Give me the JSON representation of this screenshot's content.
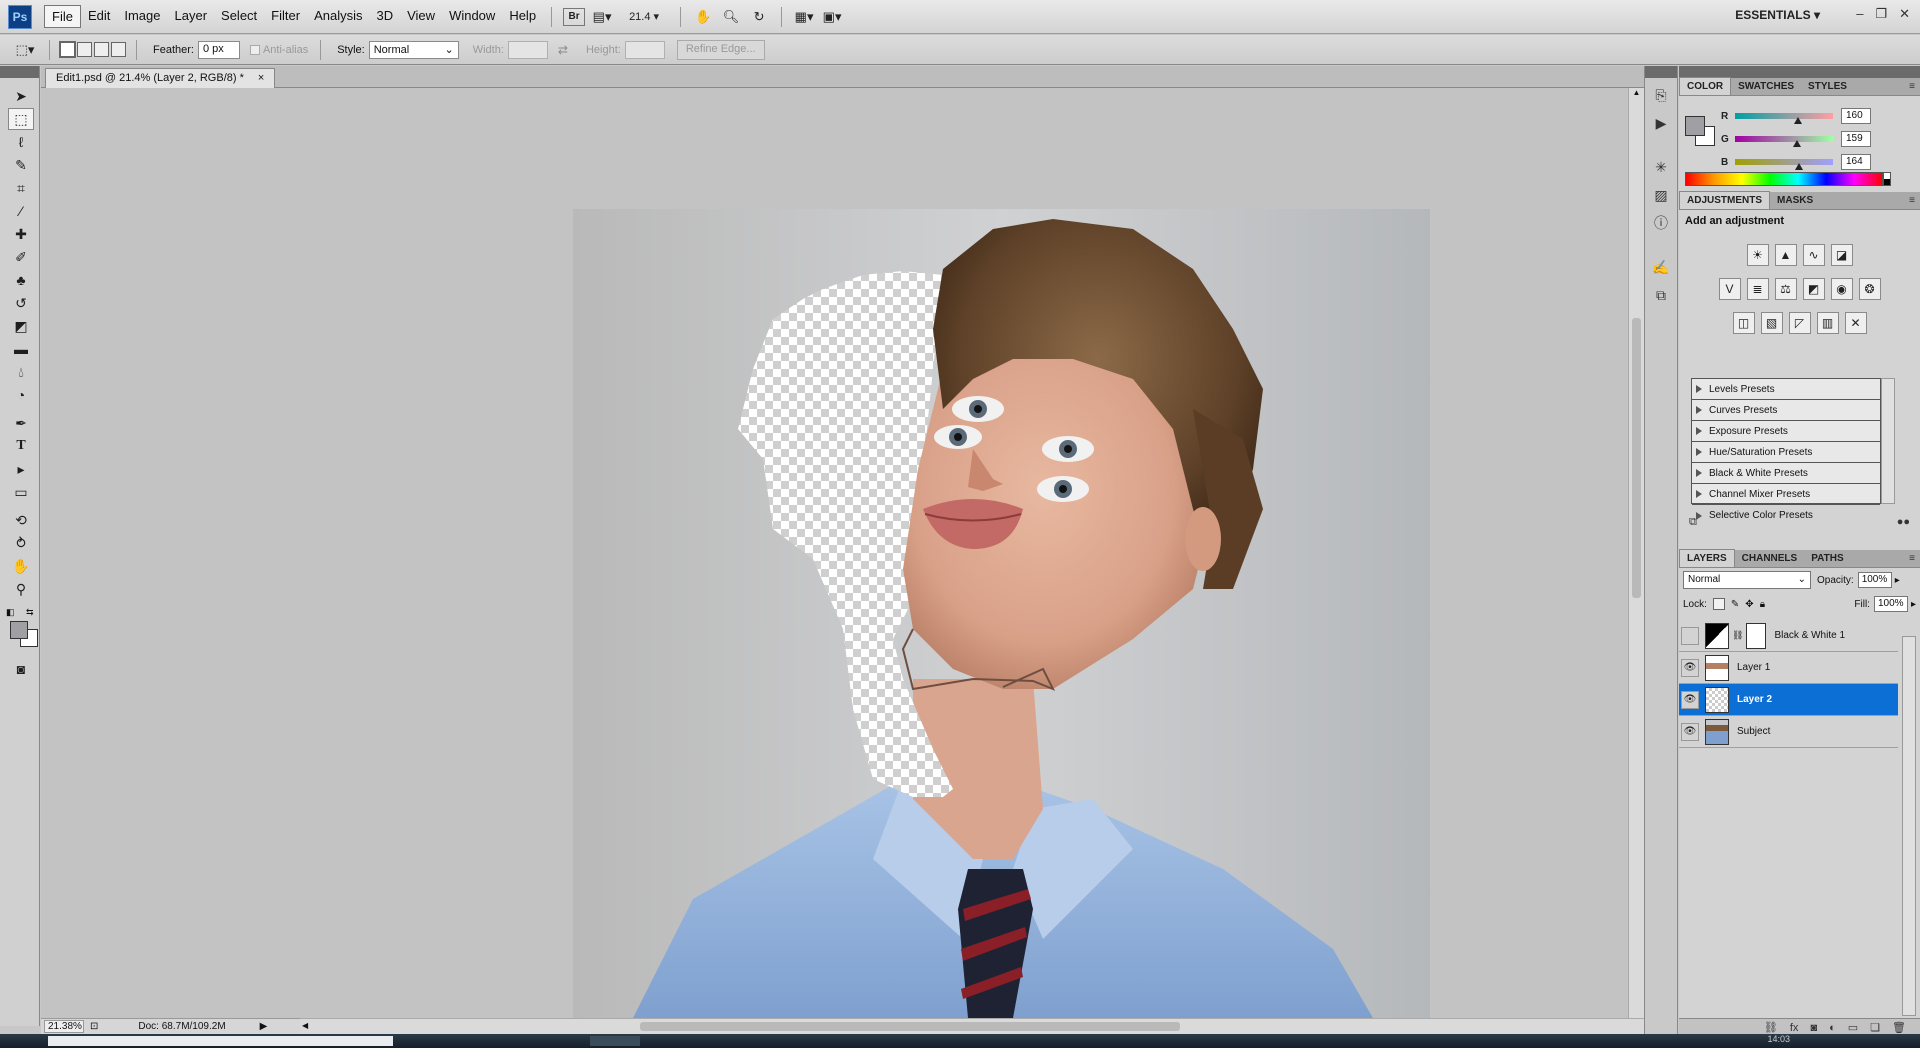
{
  "app": {
    "logo": "Ps"
  },
  "menu": [
    "File",
    "Edit",
    "Image",
    "Layer",
    "Select",
    "Filter",
    "Analysis",
    "3D",
    "View",
    "Window",
    "Help"
  ],
  "menubar": {
    "bridge_label": "Br",
    "zoom_value": "21.4",
    "workspace": "ESSENTIALS"
  },
  "options": {
    "feather_label": "Feather:",
    "feather_value": "0 px",
    "antialias_label": "Anti-alias",
    "style_label": "Style:",
    "style_value": "Normal",
    "width_label": "Width:",
    "height_label": "Height:",
    "refine_edge": "Refine Edge..."
  },
  "document": {
    "tab_title": "Edit1.psd @ 21.4% (Layer 2, RGB/8) *",
    "close": "×"
  },
  "status": {
    "zoom": "21.38%",
    "doc_size": "Doc: 68.7M/109.2M"
  },
  "taskbar": {
    "time": "14:03"
  },
  "color_panel": {
    "tabs": [
      "COLOR",
      "SWATCHES",
      "STYLES"
    ],
    "r_label": "R",
    "g_label": "G",
    "b_label": "B",
    "r_value": "160",
    "g_value": "159",
    "b_value": "164",
    "foreground": "#a09fa4"
  },
  "adjustments_panel": {
    "tabs": [
      "ADJUSTMENTS",
      "MASKS"
    ],
    "title": "Add an adjustment",
    "presets": [
      "Levels Presets",
      "Curves Presets",
      "Exposure Presets",
      "Hue/Saturation Presets",
      "Black & White Presets",
      "Channel Mixer Presets",
      "Selective Color Presets"
    ]
  },
  "layers_panel": {
    "tabs": [
      "LAYERS",
      "CHANNELS",
      "PATHS"
    ],
    "blend_mode": "Normal",
    "opacity_label": "Opacity:",
    "opacity_value": "100%",
    "lock_label": "Lock:",
    "fill_label": "Fill:",
    "fill_value": "100%",
    "layers": [
      {
        "name": "Black & White 1",
        "visible": false,
        "selected": false
      },
      {
        "name": "Layer 1",
        "visible": true,
        "selected": false
      },
      {
        "name": "Layer 2",
        "visible": true,
        "selected": true
      },
      {
        "name": "Subject",
        "visible": true,
        "selected": false
      }
    ]
  },
  "colors": {
    "accent": "#0b6fd6",
    "panel": "#d3d3d3",
    "canvas_bg": "#c3c3c3"
  }
}
